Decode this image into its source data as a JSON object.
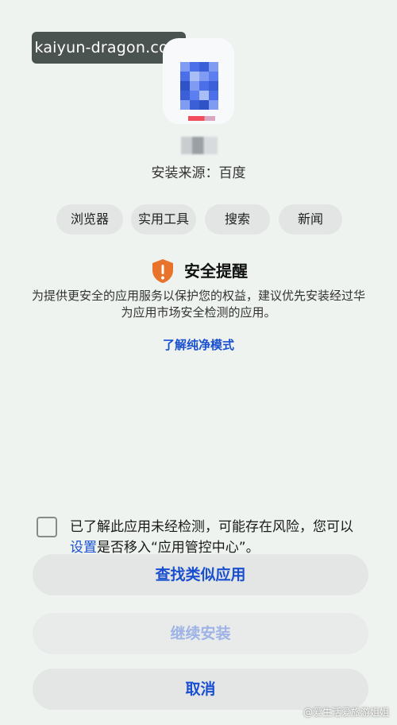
{
  "watermark": "kaiyun-dragon.com",
  "app": {
    "icon_colors": [
      "#4a6fe8",
      "#7f9bf2",
      "#3b5fd6",
      "#a9bdf6",
      "#5b7fee",
      "#2f52c6"
    ],
    "source_label": "安装来源：百度"
  },
  "tags": [
    "浏览器",
    "实用工具",
    "搜索",
    "新闻"
  ],
  "warning": {
    "icon": "shield-warning-icon",
    "accent": "#e8742c",
    "title": "安全提醒",
    "description": "为提供更安全的应用服务以保护您的权益，建议优先安装经过华为应用市场安全检测的应用。",
    "link": "了解纯净模式"
  },
  "consent": {
    "checked": false,
    "part1": "已了解此应用未经检测，可能存在风险，您可以",
    "link": "设置",
    "part2": "是否移入“应用管控中心”。"
  },
  "buttons": {
    "find_similar": "查找类似应用",
    "continue_install": "继续安装",
    "cancel": "取消"
  },
  "corner_watermark": "@爱生活爱旅游姐姐"
}
